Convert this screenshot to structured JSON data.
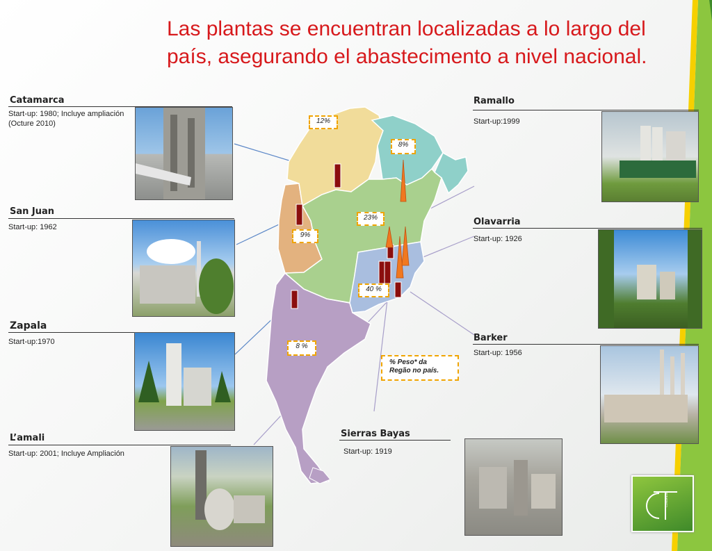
{
  "slide": {
    "title": "Las plantas se encuentran localizadas a  lo largo del país, asegurando el abastecimento a nivel nacional."
  },
  "plants": {
    "catamarca": {
      "name": "Catamarca",
      "startup_1": "Start-up: 1980; Incluye ampliación",
      "startup_2": "(Octure 2010)"
    },
    "san_juan": {
      "name": "San Juan",
      "startup": "Start-up: 1962"
    },
    "zapala": {
      "name": "Zapala",
      "startup": "Start-up:1970"
    },
    "lamali": {
      "name": "L’amali",
      "startup": "Start-up: 2001; Incluye Ampliación"
    },
    "ramallo": {
      "name": "Ramallo",
      "startup": "Start-up:1999"
    },
    "olavarria": {
      "name": "Olavarria",
      "startup": "Start-up: 1926"
    },
    "barker": {
      "name": "Barker",
      "startup": "Start-up: 1956"
    },
    "sierras_bayas": {
      "name": "Sierras Bayas",
      "startup": "Start-up: 1919"
    }
  },
  "map": {
    "labels": {
      "nw": "12%",
      "ne": "8%",
      "center": "23%",
      "cuyo": "9%",
      "pampa": "40 %",
      "south": "8 %"
    },
    "legend_line1": "% Peso* da",
    "legend_line2": "Regão no país.",
    "colors": {
      "nw": "#f1dc9a",
      "ne": "#8fd0c9",
      "center": "#a9d08e",
      "cuyo": "#e3b27f",
      "pampa": "#a9bedf",
      "south": "#b79fc4",
      "bar_dark": "#8b0e0e",
      "bar_orange": "#f07820"
    }
  },
  "logo": {
    "text": "CONGRESO TÉCNICO",
    "letters": "CT"
  },
  "accent_colors": {
    "title": "#d7191c",
    "stripe_green": "#8cc63f",
    "stripe_yellow": "#f6d000"
  }
}
